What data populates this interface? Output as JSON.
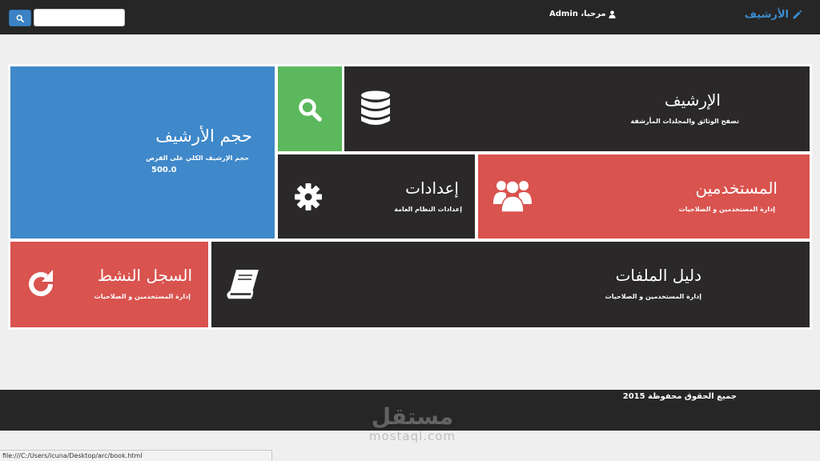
{
  "navbar": {
    "brand": "الأرشيف",
    "welcome": "مرحبا، Admin",
    "search_value": ""
  },
  "tiles": {
    "archive": {
      "title": "الإرشيف",
      "subtitle": "تصفح الوثائق والمجلدات المأرشفة",
      "icon": "database-icon"
    },
    "search": {
      "icon": "search-icon"
    },
    "size": {
      "title": "حجم الأرشيف",
      "subtitle": "حجم الإرشيف الكلي على القرص",
      "value": "500.0"
    },
    "settings": {
      "title": "إعدادات",
      "subtitle": "إعدادات النظام العامة",
      "icon": "gear-icon"
    },
    "users": {
      "title": "المستخدمين",
      "subtitle": "إدارة المستخدمين و الصلاحيات",
      "icon": "users-icon"
    },
    "files": {
      "title": "دليل الملفات",
      "subtitle": "إدارة المستخدمين و الصلاحيات",
      "icon": "book-icon"
    },
    "log": {
      "title": "السجل النشط",
      "subtitle": "إدارة المستخدمين و الصلاحيات",
      "icon": "refresh-icon"
    }
  },
  "footer": {
    "copyright": "جميع الحقوق محفوظة 2015"
  },
  "watermark": {
    "ar": "مستقل",
    "en": "mostaql.com"
  },
  "statusbar": {
    "url": "file:///C:/Users/icuna/Desktop/arc/book.html"
  },
  "colors": {
    "dark": "#2a2829",
    "blue": "#3f88c9",
    "green": "#5cb85c",
    "red": "#d9534f"
  }
}
